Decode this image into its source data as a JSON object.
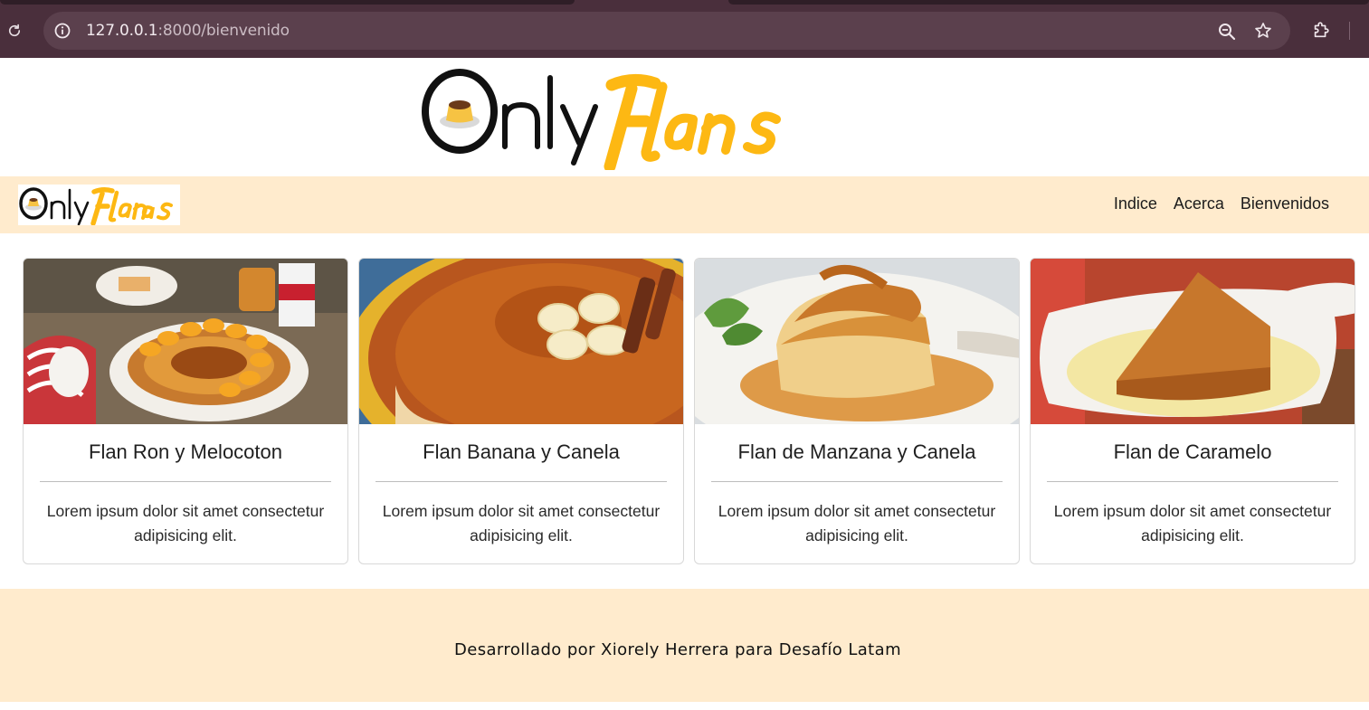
{
  "browser": {
    "url_host": "127.0.0.1",
    "url_path": ":8000/bienvenido",
    "icons": [
      "reload-icon",
      "site-info-icon",
      "zoom-icon",
      "star-icon",
      "extensions-icon"
    ]
  },
  "banner": {
    "logo_alt": "OnlyFlans"
  },
  "navbar": {
    "logo_alt": "OnlyFlans",
    "links": [
      "Indice",
      "Acerca",
      "Bienvenidos"
    ]
  },
  "cards": [
    {
      "title": "Flan Ron y Melocoton",
      "text": "Lorem ipsum dolor sit amet consectetur adipisicing elit."
    },
    {
      "title": "Flan Banana y Canela",
      "text": "Lorem ipsum dolor sit amet consectetur adipisicing elit."
    },
    {
      "title": "Flan de Manzana y Canela",
      "text": "Lorem ipsum dolor sit amet consectetur adipisicing elit."
    },
    {
      "title": "Flan de Caramelo",
      "text": "Lorem ipsum dolor sit amet consectetur adipisicing elit."
    }
  ],
  "footer": {
    "text": "Desarrollado por Xiorely Herrera para Desafío Latam"
  },
  "colors": {
    "browser_frame": "#4a2f3c",
    "navbar_bg": "#ffebcd",
    "footer_bg": "#ffebcd",
    "logo_yellow": "#fdb813"
  }
}
